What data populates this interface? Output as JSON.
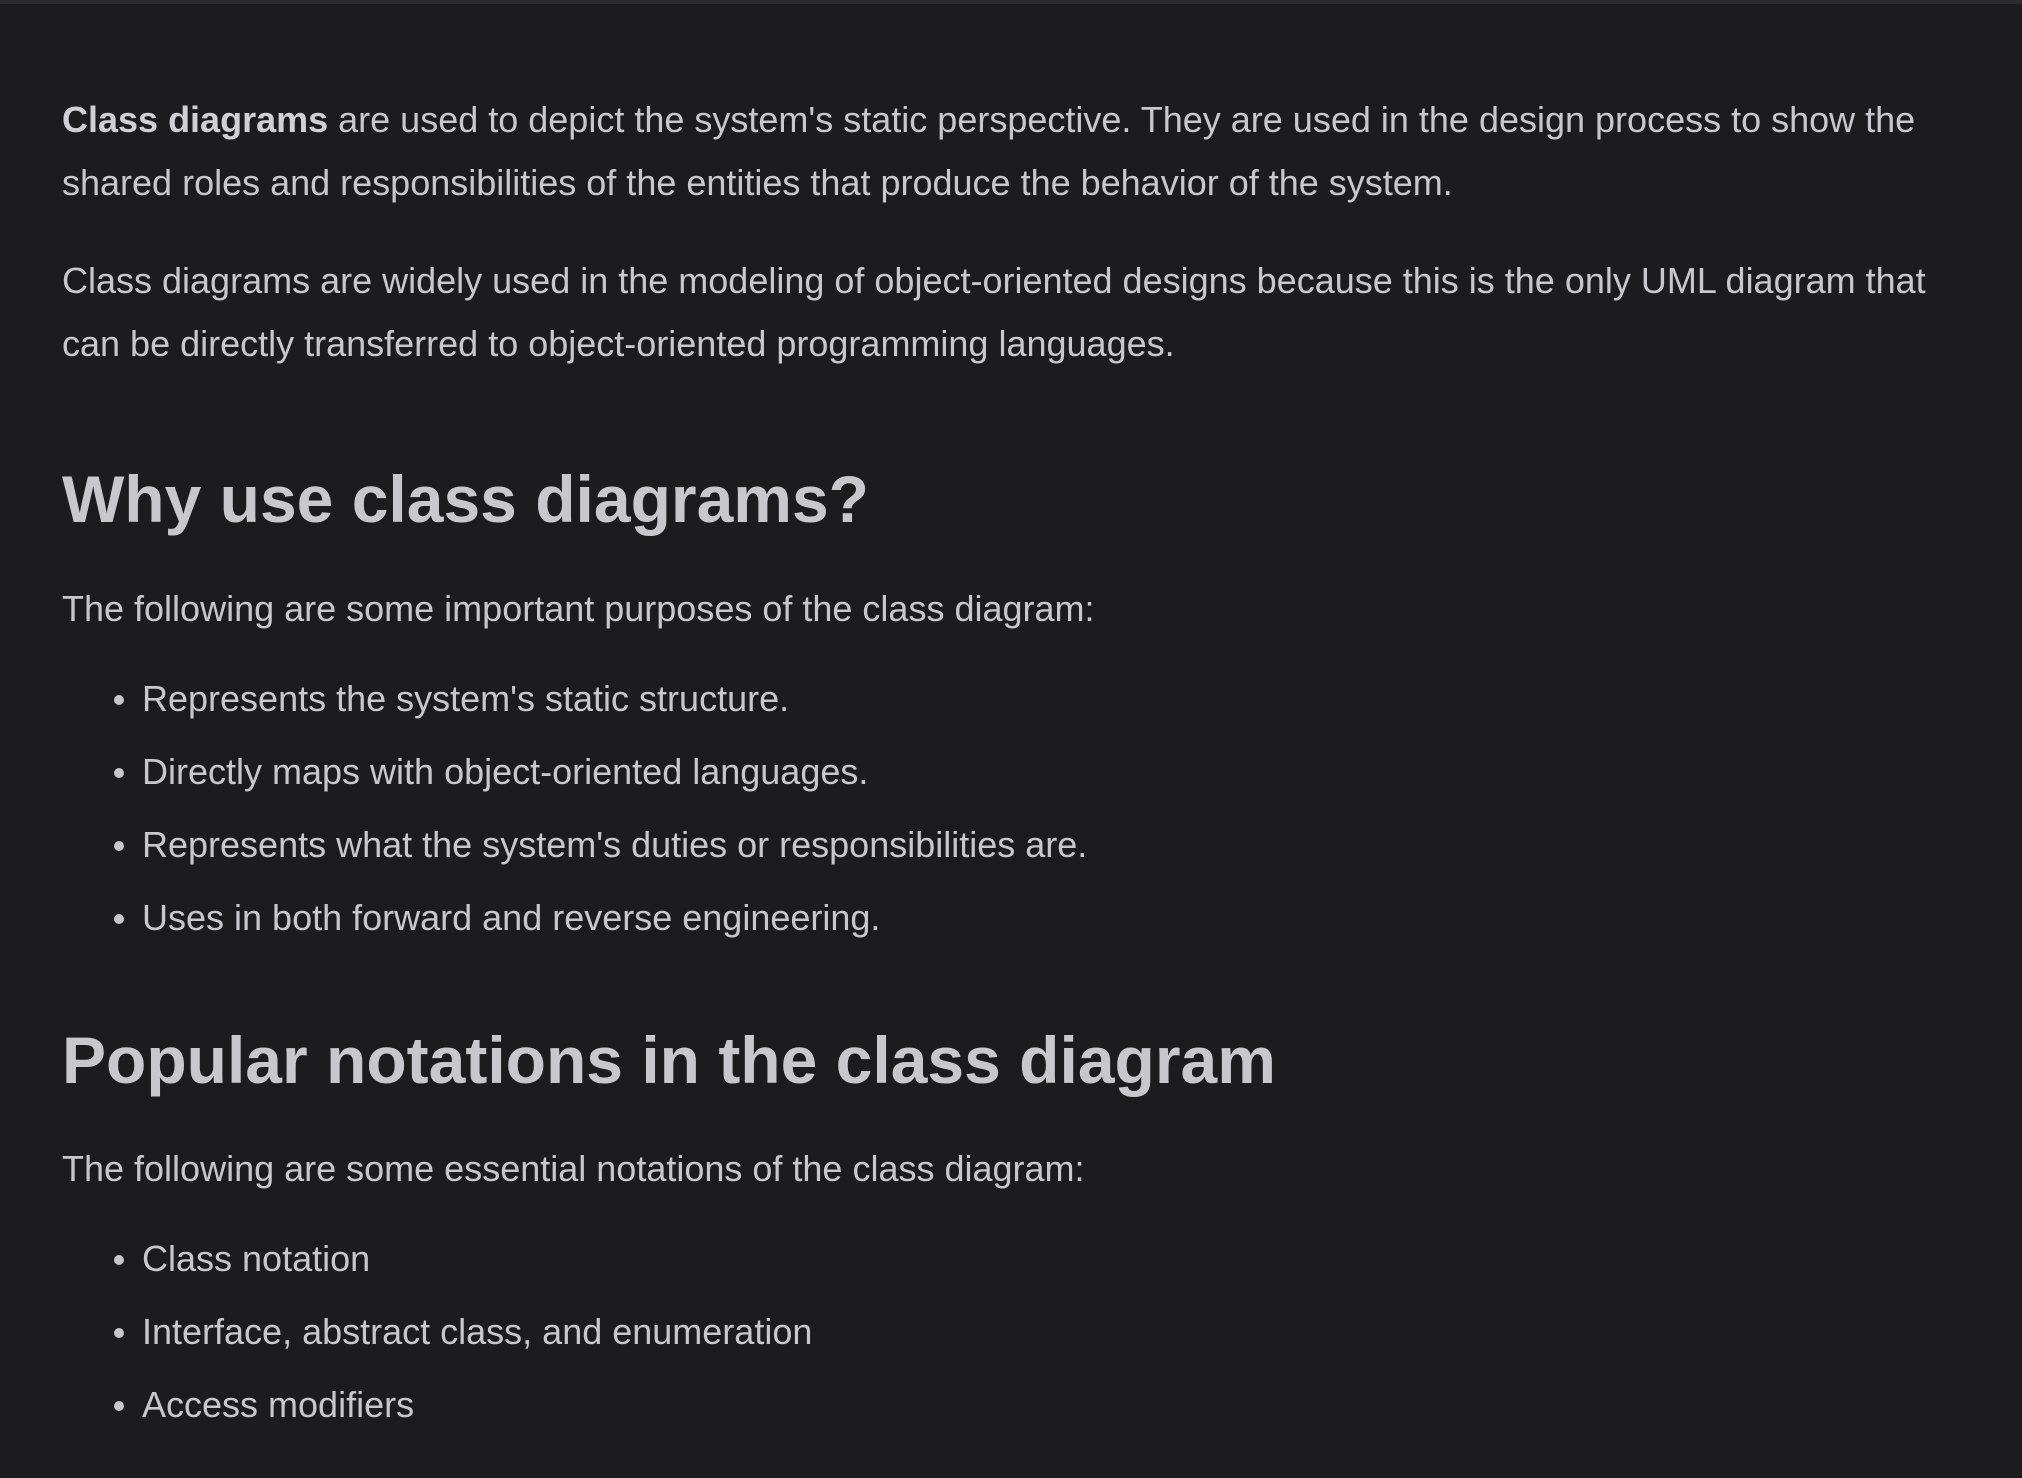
{
  "intro": {
    "p1_bold": "Class diagrams",
    "p1_rest": " are used to depict the system's static perspective. They are used in the design process to show the shared roles and responsibilities of the entities that produce the behavior of the system.",
    "p2": "Class diagrams are widely used in the modeling of object-oriented designs because this is the only UML diagram that can be directly transferred to object-oriented programming languages."
  },
  "why_section": {
    "heading": "Why use class diagrams?",
    "lead": "The following are some important purposes of the class diagram:",
    "items": [
      "Represents the system's static structure.",
      "Directly maps with object-oriented languages.",
      "Represents what the system's duties or responsibilities are.",
      "Uses in both forward and reverse engineering."
    ]
  },
  "notations_section": {
    "heading": "Popular notations in the class diagram",
    "lead": "The following are some essential notations of the class diagram:",
    "items": [
      "Class notation",
      "Interface, abstract class, and enumeration",
      "Access modifiers"
    ]
  },
  "colors": {
    "background": "#1c1c1e",
    "text": "#c8c8cc"
  }
}
